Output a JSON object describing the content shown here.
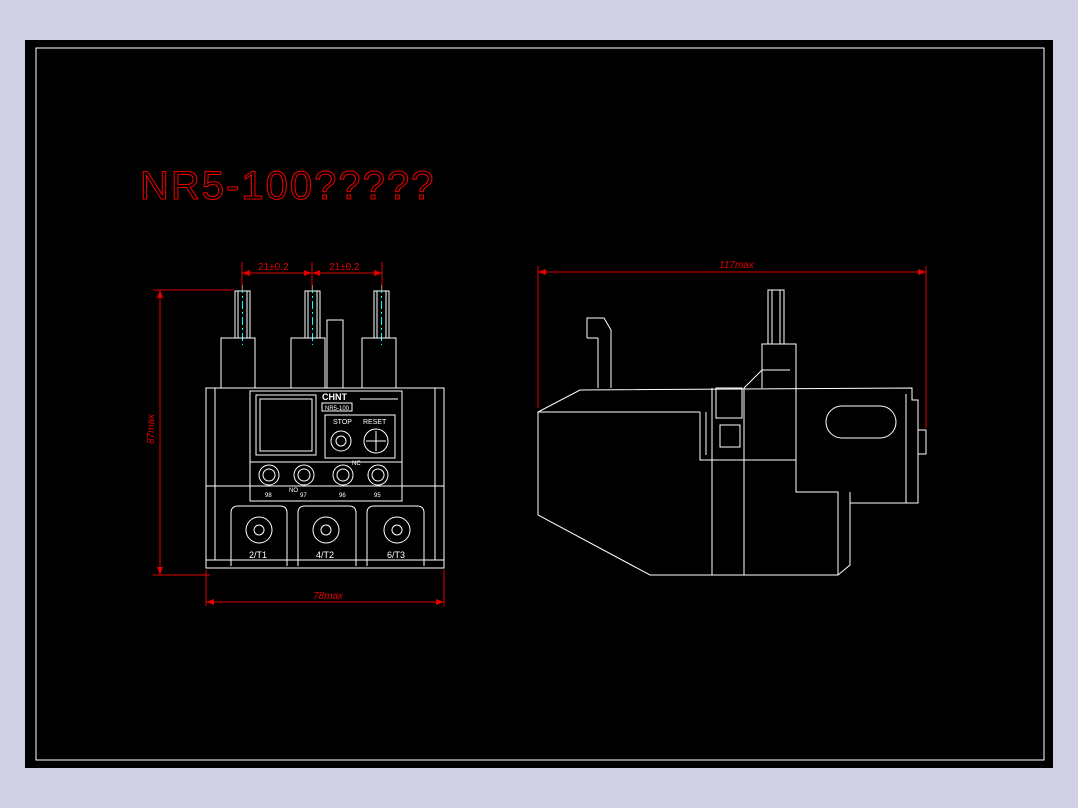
{
  "title": "NR5-100?????",
  "dimensions": {
    "pitch_left": "21±0.2",
    "pitch_right": "21±0.2",
    "height": "87max",
    "width_front": "78max",
    "length_side": "117max"
  },
  "front_view_labels": {
    "brand": "CHNT",
    "model": "NR5-100",
    "stop": "STOP",
    "reset": "RESET",
    "aux_terminals": [
      "98",
      "97",
      "96",
      "95"
    ],
    "no_label": "NO",
    "nc_label": "NC",
    "main_terminals": [
      "2/T1",
      "4/T2",
      "6/T3"
    ]
  },
  "colors": {
    "background_outer": "#cfd0e4",
    "drawing_area": "#000000",
    "border": "#ffffff",
    "dimension": "#ff0000",
    "geometry": "#ffffff",
    "centerline": "#00ffff"
  }
}
